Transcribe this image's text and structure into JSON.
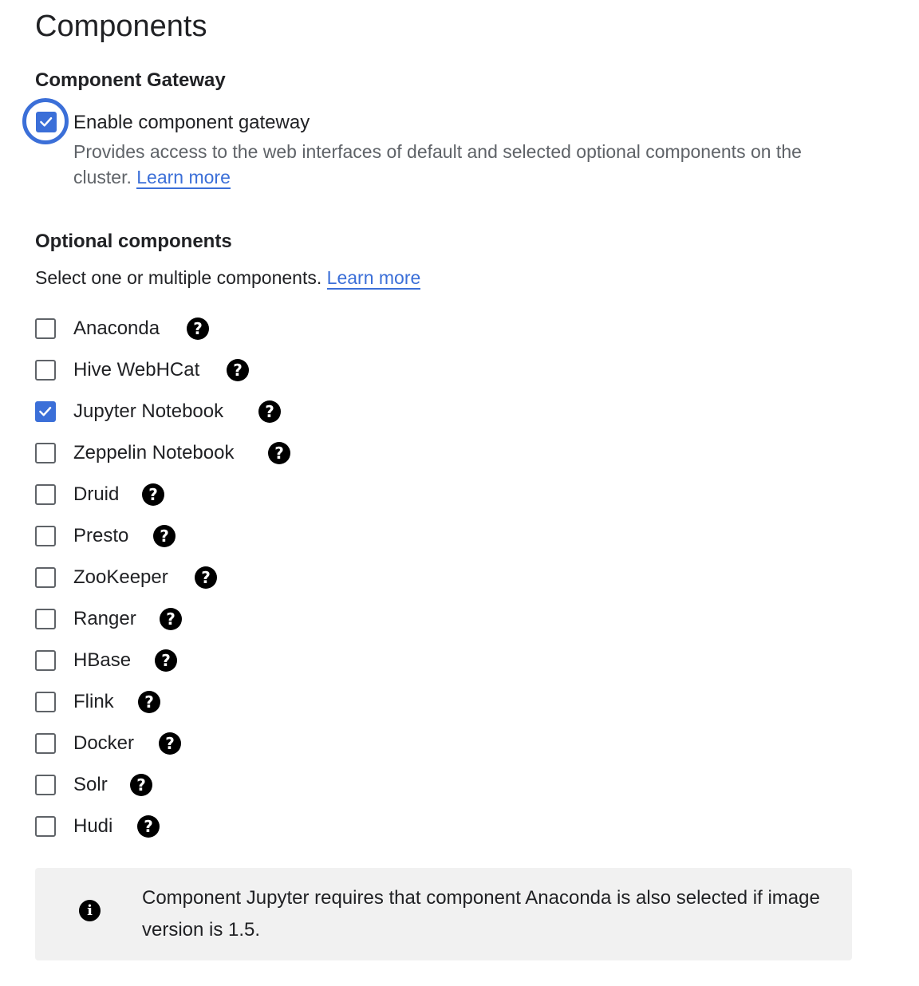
{
  "page": {
    "title": "Components"
  },
  "gateway": {
    "section_title": "Component Gateway",
    "checkbox_label": "Enable component gateway",
    "checked": true,
    "description": "Provides access to the web interfaces of default and selected optional components on the cluster.",
    "learn_more": "Learn more"
  },
  "optional": {
    "section_title": "Optional components",
    "subtitle": "Select one or multiple components.",
    "learn_more": "Learn more",
    "components": [
      {
        "label": "Anaconda",
        "checked": false
      },
      {
        "label": "Hive WebHCat",
        "checked": false
      },
      {
        "label": "Jupyter Notebook",
        "checked": true
      },
      {
        "label": "Zeppelin Notebook",
        "checked": false
      },
      {
        "label": "Druid",
        "checked": false
      },
      {
        "label": "Presto",
        "checked": false
      },
      {
        "label": "ZooKeeper",
        "checked": false
      },
      {
        "label": "Ranger",
        "checked": false
      },
      {
        "label": "HBase",
        "checked": false
      },
      {
        "label": "Flink",
        "checked": false
      },
      {
        "label": "Docker",
        "checked": false
      },
      {
        "label": "Solr",
        "checked": false
      },
      {
        "label": "Hudi",
        "checked": false
      }
    ],
    "help_icon": "help-circle-icon"
  },
  "info": {
    "icon": "info-icon",
    "text": "Component Jupyter requires that component Anaconda is also selected if image version is 1.5."
  },
  "colors": {
    "accent": "#3b6fd8",
    "text": "#202124",
    "secondary_text": "#5f6368",
    "info_background": "#f1f1f1"
  }
}
